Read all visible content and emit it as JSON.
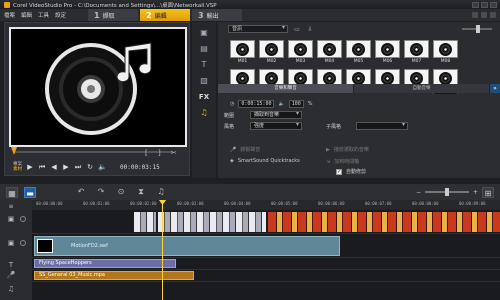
{
  "titlebar": {
    "title": "Corel VideoStudio Pro - C:\\Documents and Settings\\...\\桌面\\Networkall.VSP"
  },
  "menubar": {
    "items": [
      "檔案",
      "編輯",
      "工具",
      "設定"
    ],
    "steps": [
      {
        "num": "1",
        "label": "擷取"
      },
      {
        "num": "2",
        "label": "編輯"
      },
      {
        "num": "3",
        "label": "輸出"
      }
    ]
  },
  "player": {
    "mode_top": "專案",
    "mode_bottom": "素材",
    "timecode": "00:00:03:15",
    "brackets": "[ ] ✂"
  },
  "library": {
    "category": "音訊",
    "thumbs": [
      "M01",
      "M02",
      "M03",
      "M04",
      "M05",
      "M06",
      "M07",
      "M08",
      "M09",
      "M10",
      "M11",
      "M12",
      "M13",
      "M14",
      "M15",
      "M16"
    ]
  },
  "tabs": {
    "left": "音樂和聲音",
    "right": "自動音樂"
  },
  "options": {
    "duration": "0:00:15:00",
    "volume": "100",
    "volume_unit": "%",
    "range_label": "範圍",
    "range_value": "擷取到音樂",
    "style_label": "風格",
    "style_value": "強度",
    "subtype_label": "子風格",
    "rec_label": "錄製聲音",
    "smartsound_label": "SmartSound Quicktracks",
    "auto_label": "自動修剪",
    "play_label": "播放選取的音樂",
    "add_label": "加到時間軸"
  },
  "ruler": {
    "ticks": [
      "00:00:00:00",
      "00:00:01:00",
      "00:00:02:00",
      "00:00:03:00",
      "00:00:04:00",
      "00:00:05:00",
      "00:00:06:00",
      "00:00:07:00",
      "00:00:08:00",
      "00:00:09:00"
    ]
  },
  "timeline": {
    "overlay_clip": "MotionFD2.swf",
    "title_clip": "Flying SpaceHoppers",
    "music_clip": "SS_General 03_Music.mpa"
  },
  "colors": {
    "accent": "#f3c21b",
    "selected": "#ffb526"
  }
}
